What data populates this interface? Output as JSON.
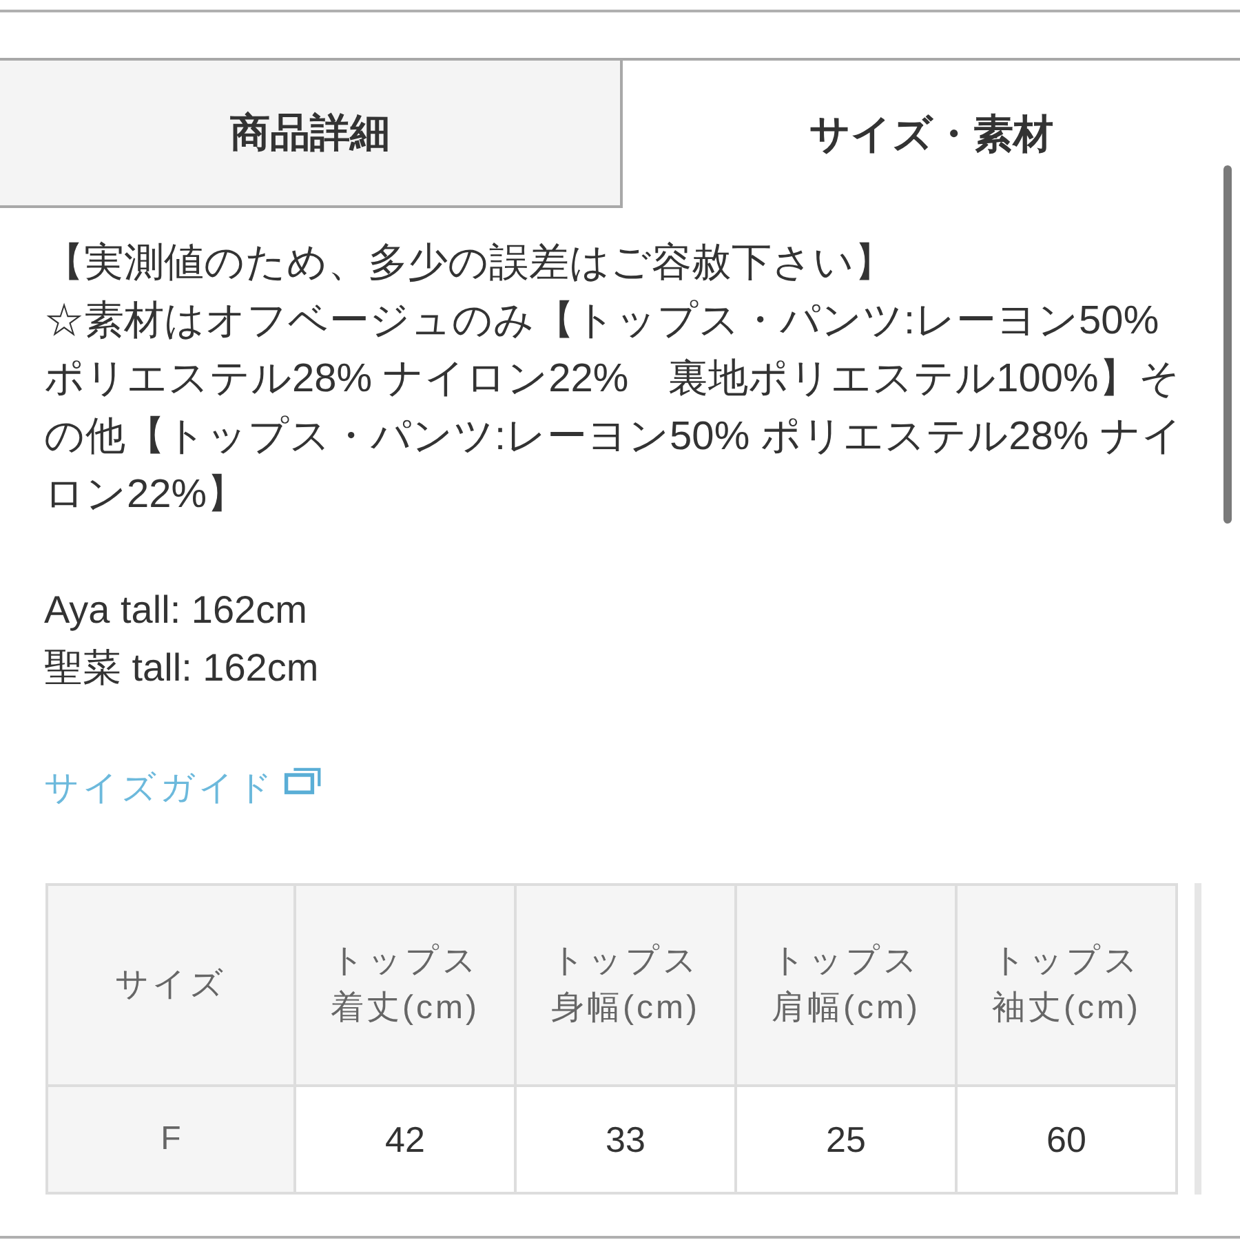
{
  "tabs": [
    {
      "label": "商品詳細",
      "selected": false
    },
    {
      "label": "サイズ・素材",
      "selected": true
    }
  ],
  "notes": [
    "【実測値のため、多少の誤差はご容赦下さい】",
    "☆素材はオフベージュのみ【トップス・パンツ:レーヨン50% ポリエステル28% ナイロン22%　裏地ポリエステル100%】その他【トップス・パンツ:レーヨン50% ポリエステル28% ナイロン22%】"
  ],
  "model_heights": [
    "Aya tall: 162cm",
    "聖菜 tall: 162cm"
  ],
  "size_guide_link": {
    "label": "サイズガイド"
  },
  "size_table": {
    "columns": [
      "サイズ",
      "トップス着丈(cm)",
      "トップス身幅(cm)",
      "トップス肩幅(cm)",
      "トップス袖丈(cm)"
    ],
    "rows": [
      [
        "F",
        "42",
        "33",
        "25",
        "60"
      ]
    ]
  }
}
